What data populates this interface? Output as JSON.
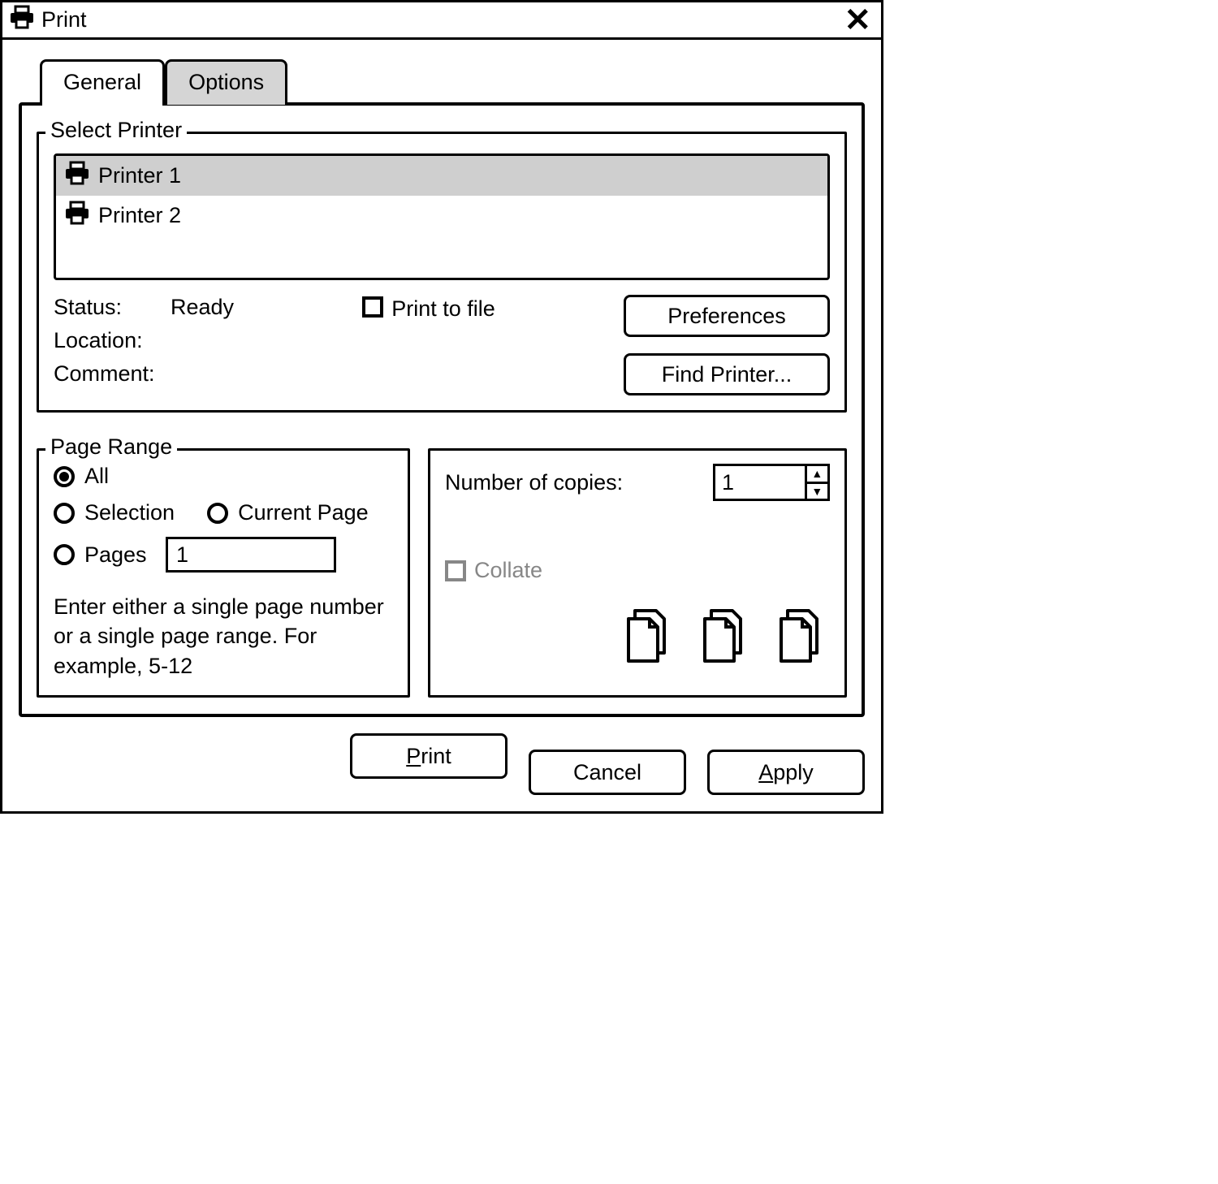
{
  "window": {
    "title": "Print"
  },
  "tabs": {
    "general": "General",
    "options": "Options"
  },
  "select_printer": {
    "legend": "Select Printer",
    "items": [
      {
        "name": "Printer 1",
        "selected": true
      },
      {
        "name": "Printer 2",
        "selected": false
      }
    ]
  },
  "meta": {
    "status_label": "Status:",
    "status_value": "Ready",
    "location_label": "Location:",
    "location_value": "",
    "comment_label": "Comment:",
    "comment_value": "",
    "print_to_file_label": "Print to file"
  },
  "buttons": {
    "preferences": "Preferences",
    "find_printer": "Find Printer...",
    "print_prefix": "P",
    "print_rest": "rint",
    "cancel": "Cancel",
    "apply_prefix": "A",
    "apply_rest": "pply"
  },
  "page_range": {
    "legend": "Page Range",
    "all": "All",
    "selection": "Selection",
    "current_page": "Current Page",
    "pages": "Pages",
    "pages_value": "1",
    "hint": "Enter either a single page number or a single page range. For example, 5-12"
  },
  "copies": {
    "label": "Number of copies:",
    "value": "1",
    "collate_label": "Collate"
  }
}
